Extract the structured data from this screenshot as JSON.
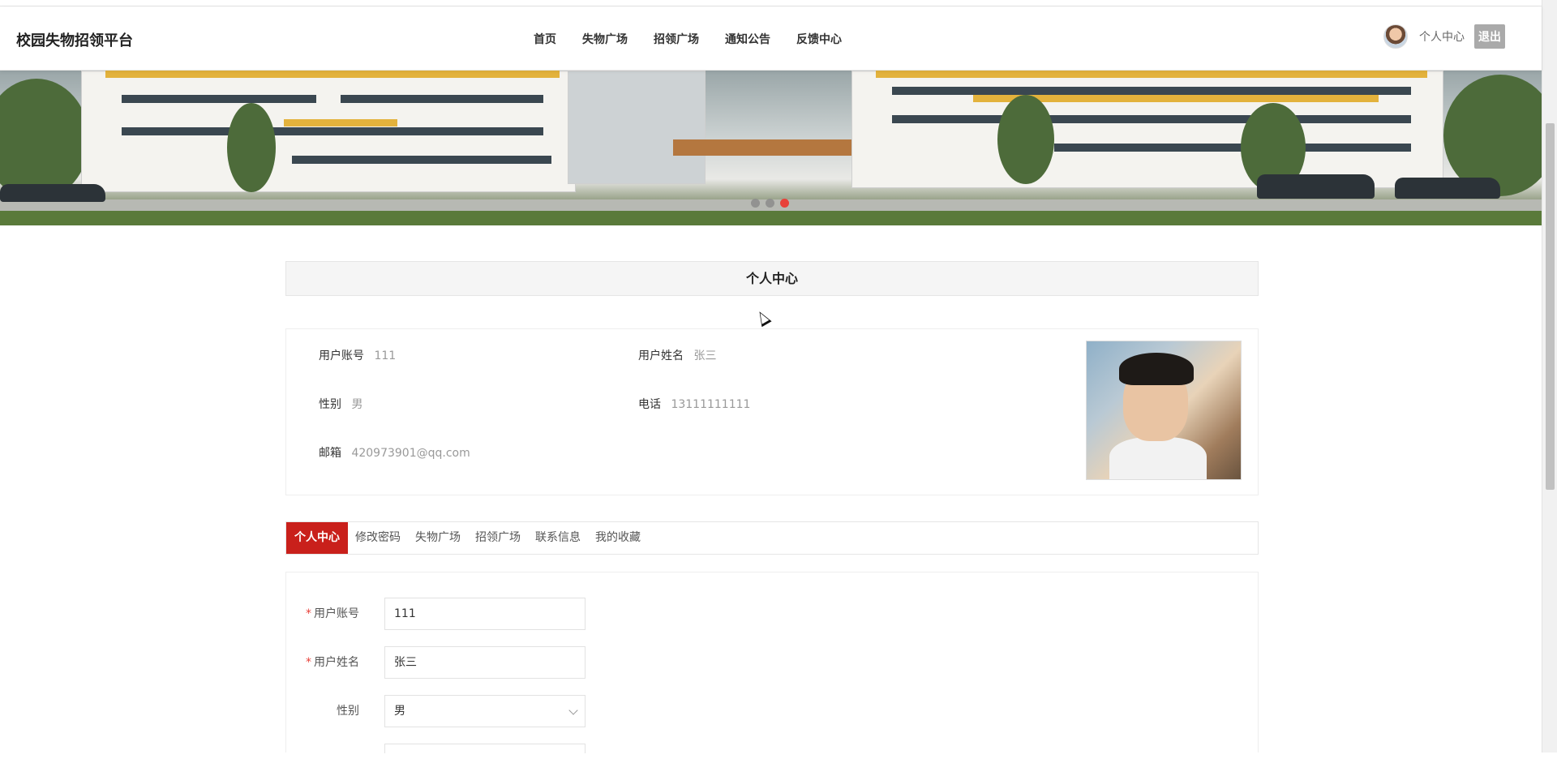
{
  "app": {
    "brand": "校园失物招领平台"
  },
  "nav": {
    "items": [
      "首页",
      "失物广场",
      "招领广场",
      "通知公告",
      "反馈中心"
    ]
  },
  "user_area": {
    "center_label": "个人中心",
    "logout_label": "退出"
  },
  "banner": {
    "active_slide": 3,
    "slide_count": 3
  },
  "section": {
    "title": "个人中心"
  },
  "profile": {
    "account_label": "用户账号",
    "account_value": "111",
    "name_label": "用户姓名",
    "name_value": "张三",
    "gender_label": "性别",
    "gender_value": "男",
    "phone_label": "电话",
    "phone_value": "13111111111",
    "email_label": "邮箱",
    "email_value": "420973901@qq.com"
  },
  "tabs": [
    "个人中心",
    "修改密码",
    "失物广场",
    "招领广场",
    "联系信息",
    "我的收藏"
  ],
  "form": {
    "account_label": "用户账号",
    "account_value": "111",
    "name_label": "用户姓名",
    "name_value": "张三",
    "gender_label": "性别",
    "gender_value": "男",
    "required_mark": "*"
  },
  "colors": {
    "accent": "#c9201b",
    "active_dot": "#e8413a"
  }
}
